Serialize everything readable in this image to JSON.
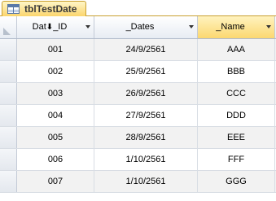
{
  "tab": {
    "label": "tblTestDate",
    "icon": "table-icon"
  },
  "columns": [
    {
      "label_pre": "Dat",
      "label_post": "_ID",
      "sort_icon": "⬇",
      "selected": false
    },
    {
      "label": "_Dates",
      "selected": false
    },
    {
      "label": "_Name",
      "selected": true
    }
  ],
  "rows": [
    {
      "id": "001",
      "date": "24/9/2561",
      "name": "AAA"
    },
    {
      "id": "002",
      "date": "25/9/2561",
      "name": "BBB"
    },
    {
      "id": "003",
      "date": "26/9/2561",
      "name": "CCC"
    },
    {
      "id": "004",
      "date": "27/9/2561",
      "name": "DDD"
    },
    {
      "id": "005",
      "date": "28/9/2561",
      "name": "EEE"
    },
    {
      "id": "006",
      "date": "1/10/2561",
      "name": "FFF"
    },
    {
      "id": "007",
      "date": "1/10/2561",
      "name": "GGG"
    }
  ],
  "colors": {
    "tab_active": "#fbd56d",
    "selected_header": "#fbd870",
    "alt_row": "#f2f2f2"
  }
}
